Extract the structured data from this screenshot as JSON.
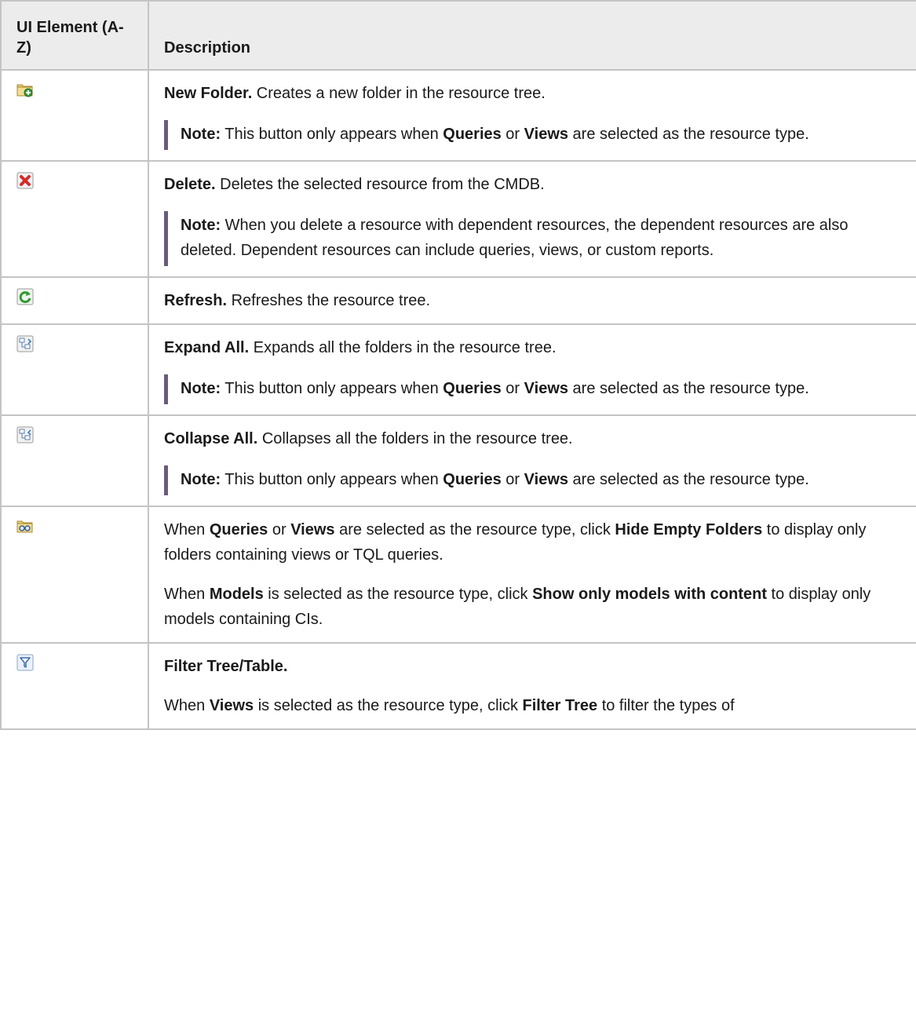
{
  "header": {
    "col1": "UI Element (A-Z)",
    "col2": "Description"
  },
  "rows": [
    {
      "icon": "new-folder-icon",
      "title": "New Folder.",
      "text": " Creates a new folder in the resource tree.",
      "note": {
        "label": "Note:",
        "t1": "  This button only appears when ",
        "b1": "Queries",
        "t2": " or ",
        "b2": "Views",
        "t3": " are selected as the resource type."
      }
    },
    {
      "icon": "delete-icon",
      "title": "Delete.",
      "text": " Deletes the selected resource from the CMDB.",
      "note": {
        "label": "Note:",
        "t1": "  When you delete a resource with dependent resources, the dependent resources are also deleted. Dependent resources can include queries, views, or custom reports."
      }
    },
    {
      "icon": "refresh-icon",
      "title": "Refresh.",
      "text": " Refreshes the resource tree."
    },
    {
      "icon": "expand-all-icon",
      "title": "Expand All.",
      "text": " Expands all the folders in the resource tree.",
      "note": {
        "label": "Note:",
        "t1": "  This button only appears when ",
        "b1": "Queries",
        "t2": " or ",
        "b2": "Views",
        "t3": " are selected as the resource type."
      }
    },
    {
      "icon": "collapse-all-icon",
      "title": "Collapse All.",
      "text": " Collapses all the folders in the resource tree.",
      "note": {
        "label": "Note:",
        "t1": "  This button only appears when ",
        "b1": "Queries",
        "t2": " or ",
        "b2": "Views",
        "t3": " are selected as the resource type."
      }
    },
    {
      "icon": "hide-empty-folders-icon",
      "p1": {
        "t1": "When ",
        "b1": "Queries",
        "t2": " or ",
        "b2": "Views",
        "t3": " are selected as the resource type, click ",
        "b3": "Hide Empty Folders",
        "t4": " to display only folders containing views or TQL queries."
      },
      "p2": {
        "t1": "When ",
        "b1": "Models",
        "t2": " is selected as the resource type, click ",
        "b2": "Show only models with content",
        "t3": " to display only models containing CIs."
      }
    },
    {
      "icon": "filter-icon",
      "title": "Filter Tree/Table.",
      "p2": {
        "t1": "When ",
        "b1": "Views",
        "t2": " is selected as the resource type, click ",
        "b2": "Filter Tree",
        "t3": " to filter the types of"
      }
    }
  ]
}
